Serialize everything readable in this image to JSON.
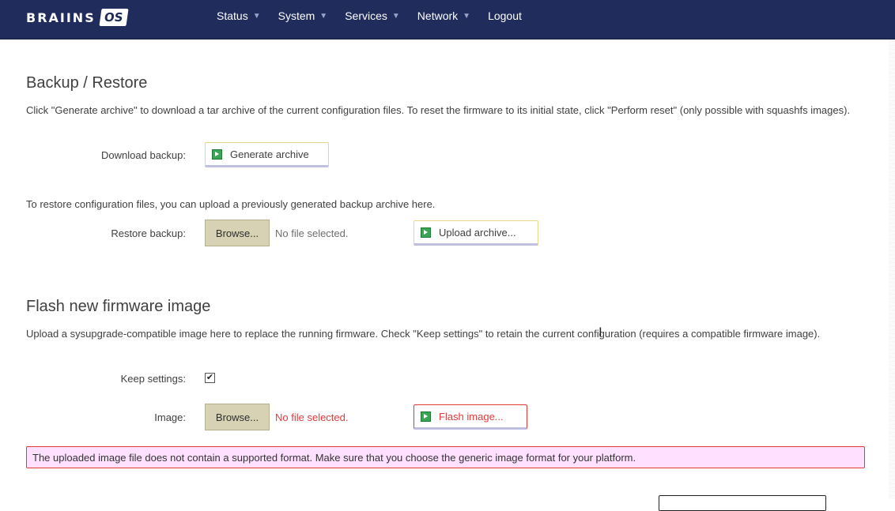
{
  "header": {
    "logo_word": "BRAIINS",
    "logo_badge": "OS",
    "nav": [
      {
        "label": "Status",
        "has_caret": true
      },
      {
        "label": "System",
        "has_caret": true
      },
      {
        "label": "Services",
        "has_caret": true
      },
      {
        "label": "Network",
        "has_caret": true
      },
      {
        "label": "Logout",
        "has_caret": false
      }
    ]
  },
  "backup": {
    "title": "Backup / Restore",
    "description": "Click \"Generate archive\" to download a tar archive of the current configuration files. To reset the firmware to its initial state, click \"Perform reset\" (only possible with squashfs images).",
    "download_label": "Download backup:",
    "generate_button": "Generate archive",
    "restore_description": "To restore configuration files, you can upload a previously generated backup archive here.",
    "restore_label": "Restore backup:",
    "browse_button": "Browse...",
    "file_status": "No file selected.",
    "upload_button": "Upload archive..."
  },
  "flash": {
    "title": "Flash new firmware image",
    "description": "Upload a sysupgrade-compatible image here to replace the running firmware. Check \"Keep settings\" to retain the current configuration (requires a compatible firmware image).",
    "keep_label": "Keep settings:",
    "keep_checked": true,
    "image_label": "Image:",
    "browse_button": "Browse...",
    "file_status": "No file selected.",
    "flash_button": "Flash image...",
    "error_message": "The uploaded image file does not contain a supported format. Make sure that you choose the generic image format for your platform."
  },
  "colors": {
    "header_bg": "#1f2c5c",
    "error": "#e23b3b",
    "alert_bg": "#ffe0ff",
    "apply_icon": "#3aa655"
  }
}
